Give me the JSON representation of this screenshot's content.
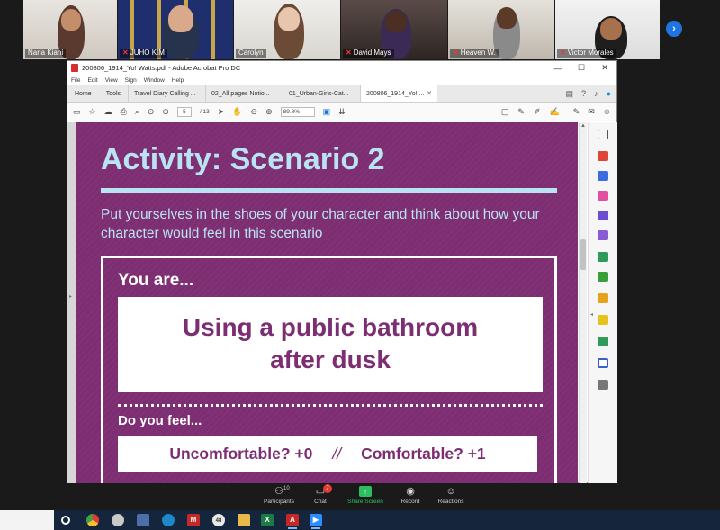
{
  "participants": [
    {
      "name": "Naria Kiani",
      "muted": false
    },
    {
      "name": "JUHO KIM",
      "muted": true
    },
    {
      "name": "Carolyn",
      "muted": false
    },
    {
      "name": "David Mays",
      "muted": true
    },
    {
      "name": "Heaven W.",
      "muted": true
    },
    {
      "name": "Victor Morales",
      "muted": true
    }
  ],
  "acrobat": {
    "window_title": "200806_1914_Yo! Watts.pdf - Adobe Acrobat Pro DC",
    "menu": [
      "File",
      "Edit",
      "View",
      "Sign",
      "Window",
      "Help"
    ],
    "nav": {
      "home": "Home",
      "tools": "Tools"
    },
    "tabs": [
      {
        "label": "Travel Diary Calling ...",
        "active": false
      },
      {
        "label": "02_All pages Notio...",
        "active": false
      },
      {
        "label": "01_Urban-Girls-Cat...",
        "active": false
      },
      {
        "label": "200806_1914_Yo! ...",
        "active": true
      }
    ],
    "toolbar": {
      "page_current": "5",
      "page_total": "/ 13",
      "zoom": "89.8%"
    }
  },
  "slide": {
    "title": "Activity: Scenario 2",
    "subtitle": "Put yourselves in the shoes of your character and think about how your character would feel in this scenario",
    "you_are": "You are...",
    "scenario_line1": "Using a public bathroom",
    "scenario_line2": "after dusk",
    "feel_prompt": "Do you feel...",
    "option_uncomfortable": "Uncomfortable? +0",
    "separator": "//",
    "option_comfortable": "Comfortable? +1"
  },
  "zoom_controls": {
    "participants_label": "Participants",
    "participants_count": "10",
    "chat_label": "Chat",
    "chat_badge": "7",
    "share_label": "Share Screen",
    "record_label": "Record",
    "reactions_label": "Reactions"
  },
  "taskbar": {
    "icons": [
      "windows-circle",
      "chrome",
      "app",
      "calculator",
      "edge",
      "mcafee",
      "app-48",
      "file-explorer",
      "excel",
      "acrobat",
      "zoom"
    ],
    "badge_48": "48"
  },
  "colors": {
    "slide_purple": "#7d2d72",
    "slide_accent": "#b9e3f0",
    "share_green": "#2dbe60"
  }
}
